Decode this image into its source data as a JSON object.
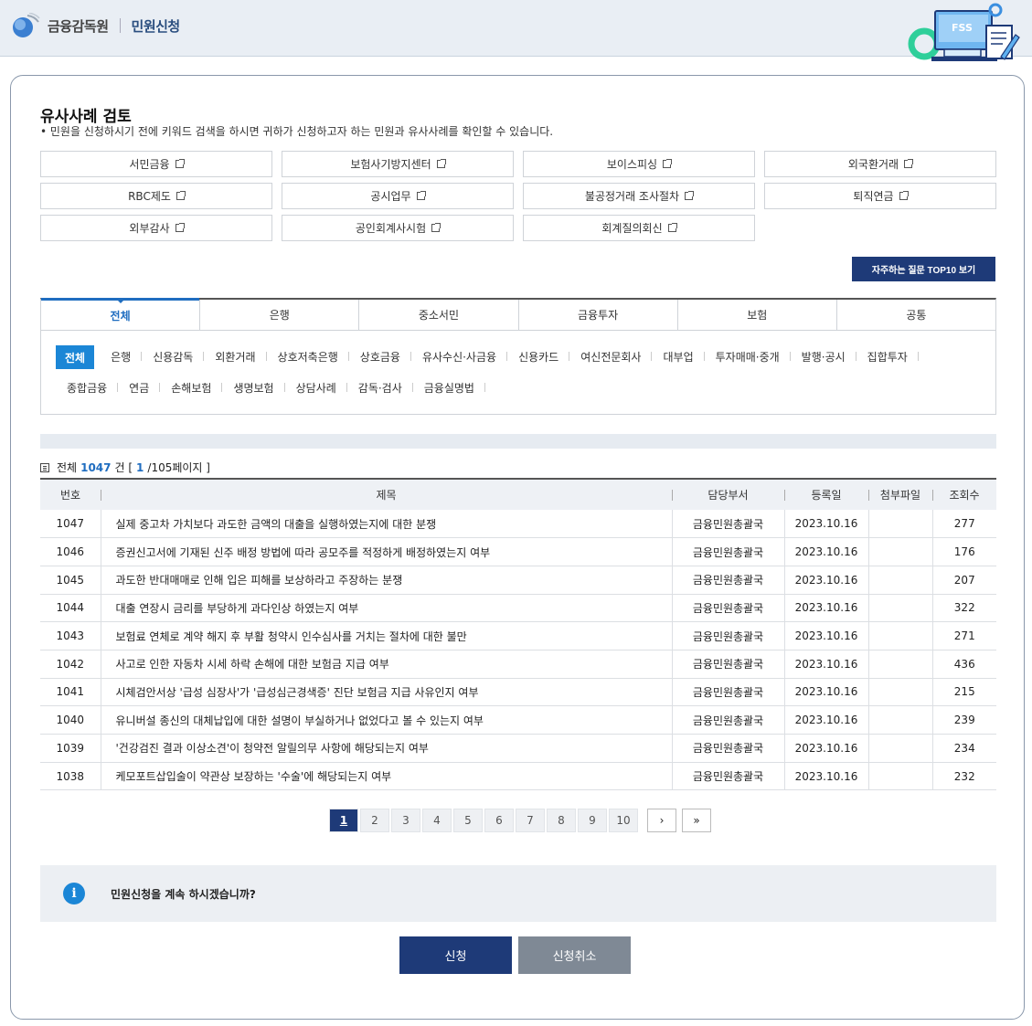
{
  "header": {
    "brand": "금융감독원",
    "service": "민원신청",
    "illustration_label": "FSS"
  },
  "section": {
    "title": "유사사례 검토",
    "description": "• 민원을 신청하시기 전에 키워드 검색을 하시면 귀하가 신청하고자 하는 민원과 유사사례를 확인할 수 있습니다."
  },
  "links": [
    "서민금융",
    "보험사기방지센터",
    "보이스피싱",
    "외국환거래",
    "RBC제도",
    "공시업무",
    "불공정거래 조사절차",
    "퇴직연금",
    "외부감사",
    "공인회계사시험",
    "회계질의회신"
  ],
  "top10_button": "자주하는 질문 TOP10 보기",
  "tabs": [
    "전체",
    "은행",
    "중소서민",
    "금융투자",
    "보험",
    "공통"
  ],
  "active_tab": "전체",
  "subcategories": [
    "전체",
    "은행",
    "신용감독",
    "외환거래",
    "상호저축은행",
    "상호금융",
    "유사수신·사금융",
    "신용카드",
    "여신전문회사",
    "대부업",
    "투자매매·중개",
    "발행·공시",
    "집합투자",
    "종합금융",
    "연금",
    "손해보험",
    "생명보험",
    "상담사례",
    "감독·검사",
    "금융실명법"
  ],
  "active_subcategory": "전체",
  "summary": {
    "prefix": "전체",
    "total": "1047",
    "unit": "건 [",
    "page": "1",
    "pages_suffix": "/105페이지 ]"
  },
  "table": {
    "headers": [
      "번호",
      "제목",
      "담당부서",
      "등록일",
      "첨부파일",
      "조회수"
    ],
    "rows": [
      {
        "no": "1047",
        "title": "실제 중고차 가치보다 과도한 금액의 대출을 실행하였는지에 대한 분쟁",
        "dept": "금융민원총괄국",
        "date": "2023.10.16",
        "file": "",
        "views": "277"
      },
      {
        "no": "1046",
        "title": "증권신고서에 기재된 신주 배정 방법에 따라 공모주를 적정하게 배정하였는지 여부",
        "dept": "금융민원총괄국",
        "date": "2023.10.16",
        "file": "",
        "views": "176"
      },
      {
        "no": "1045",
        "title": "과도한 반대매매로 인해 입은 피해를 보상하라고 주장하는 분쟁",
        "dept": "금융민원총괄국",
        "date": "2023.10.16",
        "file": "",
        "views": "207"
      },
      {
        "no": "1044",
        "title": "대출 연장시 금리를 부당하게 과다인상 하였는지 여부",
        "dept": "금융민원총괄국",
        "date": "2023.10.16",
        "file": "",
        "views": "322"
      },
      {
        "no": "1043",
        "title": "보험료 연체로 계약 해지 후 부활 청약시 인수심사를 거치는 절차에 대한 불만",
        "dept": "금융민원총괄국",
        "date": "2023.10.16",
        "file": "",
        "views": "271"
      },
      {
        "no": "1042",
        "title": "사고로 인한 자동차 시세 하락 손해에 대한 보험금 지급 여부",
        "dept": "금융민원총괄국",
        "date": "2023.10.16",
        "file": "",
        "views": "436"
      },
      {
        "no": "1041",
        "title": "시체검안서상 '급성 심장사'가 '급성심근경색증' 진단 보험금 지급 사유인지 여부",
        "dept": "금융민원총괄국",
        "date": "2023.10.16",
        "file": "",
        "views": "215"
      },
      {
        "no": "1040",
        "title": "유니버설 종신의 대체납입에 대한 설명이 부실하거나 없었다고 볼 수 있는지 여부",
        "dept": "금융민원총괄국",
        "date": "2023.10.16",
        "file": "",
        "views": "239"
      },
      {
        "no": "1039",
        "title": "'건강검진 결과 이상소견'이 청약전 알릴의무 사항에 해당되는지 여부",
        "dept": "금융민원총괄국",
        "date": "2023.10.16",
        "file": "",
        "views": "234"
      },
      {
        "no": "1038",
        "title": "케모포트삽입술이 약관상 보장하는 '수술'에 해당되는지 여부",
        "dept": "금융민원총괄국",
        "date": "2023.10.16",
        "file": "",
        "views": "232"
      }
    ]
  },
  "pagination": {
    "pages": [
      "1",
      "2",
      "3",
      "4",
      "5",
      "6",
      "7",
      "8",
      "9",
      "10"
    ],
    "current": "1",
    "next": "›",
    "last": "»"
  },
  "notice": {
    "icon": "i",
    "text": "민원신청을 계속 하시겠습니까?"
  },
  "actions": {
    "apply": "신청",
    "cancel": "신청취소"
  },
  "colors": {
    "accent": "#1f6dc0",
    "navy": "#1e3a78",
    "gray_button": "#7f8995"
  }
}
